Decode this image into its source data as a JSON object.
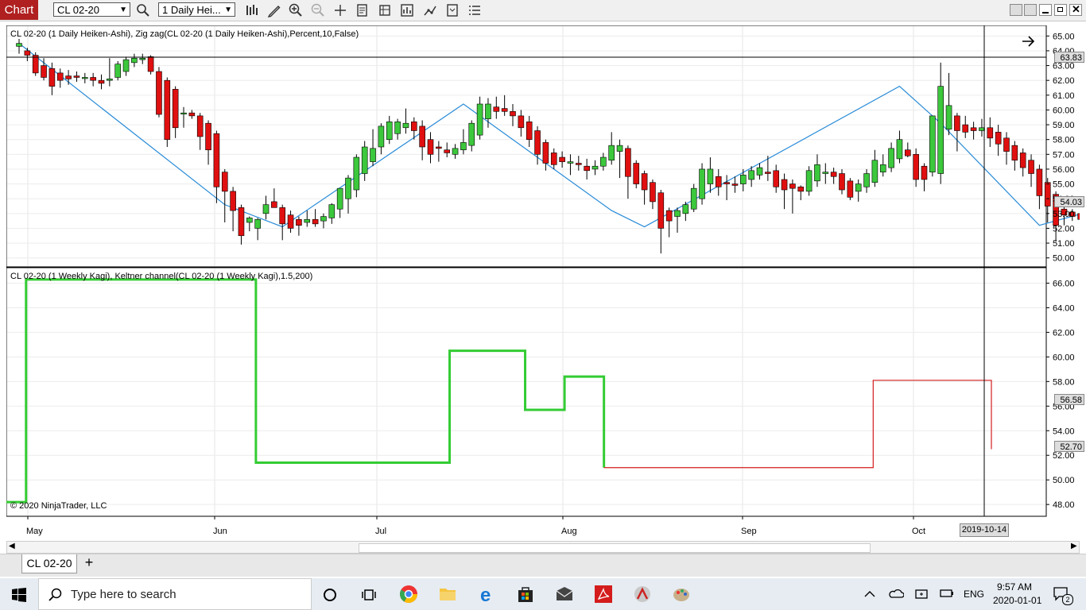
{
  "toolbar": {
    "chart_label": "Chart",
    "instrument": "CL 02-20",
    "period": "1 Daily Hei..."
  },
  "top_panel": {
    "label": "CL 02-20 (1 Daily Heiken-Ashi), Zig zag(CL 02-20 (1 Daily Heiken-Ashi),Percent,10,False)",
    "y_ticks": [
      "65.00",
      "64.00",
      "63.00",
      "62.00",
      "61.00",
      "60.00",
      "59.00",
      "58.00",
      "57.00",
      "56.00",
      "55.00",
      "54.00",
      "53.00",
      "52.00",
      "51.00",
      "50.00"
    ],
    "crosshair_price": "63.83",
    "last_price": "54.03"
  },
  "bottom_panel": {
    "label": "CL 02-20 (1 Weekly Kagi), Keltner channel(CL 02-20 (1 Weekly Kagi),1.5,200)",
    "y_ticks": [
      "66.00",
      "64.00",
      "62.00",
      "60.00",
      "58.00",
      "56.00",
      "54.00",
      "52.00",
      "50.00",
      "48.00"
    ],
    "price_box_1": "56.58",
    "price_box_2": "52.70",
    "copyright": "© 2020 NinjaTrader, LLC"
  },
  "x_axis": {
    "labels": [
      "May",
      "Jun",
      "Jul",
      "Aug",
      "Sep",
      "Oct"
    ],
    "crosshair_date": "2019-10-14"
  },
  "chart_data": [
    {
      "type": "candlestick",
      "title": "CL 02-20 (1 Daily Heiken-Ashi), Zig zag(CL 02-20 (1 Daily Heiken-Ashi),Percent,10,False)",
      "ylim": [
        49.5,
        65.5
      ],
      "candles": [
        [
          64.3,
          64.8,
          63.8,
          64.5
        ],
        [
          64.0,
          64.2,
          63.3,
          63.7
        ],
        [
          63.7,
          63.9,
          62.3,
          62.5
        ],
        [
          63.0,
          63.5,
          62.0,
          62.2
        ],
        [
          62.8,
          63.2,
          61.0,
          61.6
        ],
        [
          62.5,
          62.8,
          61.5,
          62.0
        ],
        [
          62.3,
          62.7,
          61.7,
          62.1
        ],
        [
          62.3,
          62.6,
          61.9,
          62.2
        ],
        [
          62.2,
          62.5,
          61.8,
          62.2
        ],
        [
          62.2,
          62.5,
          61.6,
          62.0
        ],
        [
          62.0,
          62.4,
          61.4,
          61.8
        ],
        [
          62.0,
          63.5,
          61.6,
          62.1
        ],
        [
          62.2,
          63.3,
          62.0,
          63.1
        ],
        [
          62.6,
          63.6,
          62.3,
          63.4
        ],
        [
          63.2,
          63.8,
          62.9,
          63.5
        ],
        [
          63.4,
          63.8,
          63.1,
          63.5
        ],
        [
          63.6,
          63.7,
          62.4,
          62.6
        ],
        [
          62.6,
          62.9,
          59.5,
          59.7
        ],
        [
          62.0,
          62.2,
          57.5,
          58.0
        ],
        [
          61.4,
          61.6,
          58.1,
          58.8
        ],
        [
          59.8,
          60.2,
          58.8,
          59.8
        ],
        [
          59.8,
          60.0,
          59.4,
          59.6
        ],
        [
          59.6,
          59.8,
          57.3,
          58.2
        ],
        [
          59.1,
          59.3,
          56.3,
          57.3
        ],
        [
          58.4,
          58.6,
          53.7,
          54.8
        ],
        [
          55.8,
          56.0,
          52.4,
          54.5
        ],
        [
          54.5,
          54.8,
          51.8,
          53.2
        ],
        [
          53.4,
          53.6,
          50.9,
          51.5
        ],
        [
          52.4,
          52.8,
          51.8,
          52.7
        ],
        [
          52.0,
          52.7,
          51.2,
          52.6
        ],
        [
          53.0,
          54.2,
          52.6,
          53.6
        ],
        [
          53.8,
          54.7,
          53.5,
          53.4
        ],
        [
          53.4,
          53.6,
          51.2,
          52.3
        ],
        [
          52.9,
          53.2,
          51.7,
          52.0
        ],
        [
          52.6,
          52.8,
          51.5,
          52.2
        ],
        [
          52.4,
          53.2,
          52.1,
          52.6
        ],
        [
          52.6,
          53.3,
          52.1,
          52.3
        ],
        [
          52.5,
          53.0,
          52.0,
          52.8
        ],
        [
          52.7,
          53.7,
          52.3,
          53.6
        ],
        [
          53.3,
          54.6,
          52.7,
          54.7
        ],
        [
          54.0,
          55.6,
          53.0,
          55.4
        ],
        [
          54.6,
          57.0,
          54.1,
          56.8
        ],
        [
          55.7,
          57.9,
          55.2,
          57.5
        ],
        [
          56.5,
          58.7,
          56.2,
          57.4
        ],
        [
          57.5,
          59.1,
          57.0,
          58.9
        ],
        [
          58.0,
          59.6,
          57.7,
          59.2
        ],
        [
          58.4,
          59.4,
          58.0,
          59.2
        ],
        [
          58.8,
          60.1,
          58.4,
          59.1
        ],
        [
          59.2,
          59.5,
          58.0,
          58.6
        ],
        [
          58.9,
          59.3,
          56.6,
          57.5
        ],
        [
          58.0,
          58.5,
          56.4,
          57.0
        ],
        [
          57.5,
          57.9,
          56.5,
          57.4
        ],
        [
          57.3,
          57.8,
          56.8,
          57.1
        ],
        [
          57.0,
          57.7,
          56.7,
          57.4
        ],
        [
          57.3,
          58.7,
          57.0,
          57.8
        ],
        [
          57.6,
          59.3,
          57.2,
          59.1
        ],
        [
          58.3,
          60.9,
          58.0,
          60.4
        ],
        [
          59.4,
          60.8,
          58.8,
          60.4
        ],
        [
          60.2,
          60.9,
          59.4,
          59.9
        ],
        [
          60.1,
          61.0,
          59.6,
          59.9
        ],
        [
          59.9,
          60.4,
          58.9,
          59.6
        ],
        [
          59.6,
          60.0,
          58.2,
          58.8
        ],
        [
          59.2,
          59.6,
          57.5,
          58.0
        ],
        [
          58.6,
          58.9,
          56.3,
          57.0
        ],
        [
          57.8,
          58.0,
          55.9,
          56.4
        ],
        [
          57.1,
          57.4,
          56.0,
          56.3
        ],
        [
          56.8,
          57.2,
          56.1,
          56.5
        ],
        [
          56.4,
          57.0,
          55.6,
          56.5
        ],
        [
          56.4,
          56.9,
          55.9,
          56.3
        ],
        [
          56.2,
          56.7,
          55.3,
          55.9
        ],
        [
          56.0,
          56.6,
          55.6,
          56.2
        ],
        [
          56.2,
          57.1,
          55.9,
          56.8
        ],
        [
          56.6,
          58.5,
          56.3,
          57.6
        ],
        [
          57.2,
          58.0,
          55.4,
          57.6
        ],
        [
          57.4,
          57.6,
          54.0,
          55.5
        ],
        [
          56.4,
          56.6,
          54.7,
          55.0
        ],
        [
          55.7,
          55.9,
          53.6,
          54.6
        ],
        [
          55.1,
          55.3,
          53.3,
          53.8
        ],
        [
          54.4,
          54.6,
          50.3,
          52.0
        ],
        [
          53.2,
          53.4,
          51.4,
          52.5
        ],
        [
          52.8,
          53.4,
          51.7,
          53.2
        ],
        [
          53.0,
          53.8,
          52.5,
          53.6
        ],
        [
          53.3,
          55.0,
          53.1,
          54.7
        ],
        [
          54.0,
          56.4,
          53.6,
          56.0
        ],
        [
          55.0,
          56.8,
          54.4,
          56.0
        ],
        [
          55.5,
          56.0,
          54.2,
          54.8
        ],
        [
          55.1,
          55.6,
          53.9,
          55.0
        ],
        [
          55.0,
          55.5,
          54.4,
          54.9
        ],
        [
          55.0,
          56.0,
          54.5,
          55.6
        ],
        [
          55.3,
          56.2,
          54.8,
          55.9
        ],
        [
          55.6,
          56.4,
          55.3,
          56.1
        ],
        [
          55.8,
          56.9,
          55.2,
          55.7
        ],
        [
          55.9,
          56.3,
          54.4,
          54.8
        ],
        [
          55.3,
          55.7,
          53.3,
          54.6
        ],
        [
          55.0,
          55.3,
          53.0,
          54.7
        ],
        [
          54.8,
          54.9,
          53.9,
          54.5
        ],
        [
          54.5,
          56.2,
          54.2,
          55.9
        ],
        [
          55.2,
          57.0,
          54.8,
          56.3
        ],
        [
          55.7,
          56.4,
          55.0,
          55.8
        ],
        [
          55.8,
          56.1,
          55.0,
          55.5
        ],
        [
          55.7,
          56.0,
          54.3,
          54.6
        ],
        [
          55.2,
          55.4,
          53.9,
          54.1
        ],
        [
          54.5,
          55.3,
          53.8,
          55.0
        ],
        [
          54.8,
          56.0,
          54.4,
          55.7
        ],
        [
          55.1,
          57.3,
          54.8,
          56.6
        ],
        [
          55.8,
          57.0,
          55.5,
          56.3
        ],
        [
          56.1,
          57.8,
          55.8,
          57.4
        ],
        [
          56.7,
          58.6,
          56.4,
          58.0
        ],
        [
          57.3,
          57.8,
          56.8,
          56.9
        ],
        [
          57.0,
          57.4,
          54.8,
          55.3
        ],
        [
          56.2,
          56.4,
          54.5,
          55.3
        ],
        [
          55.8,
          58.1,
          55.5,
          59.6
        ],
        [
          55.7,
          63.2,
          55.0,
          61.6
        ],
        [
          58.7,
          62.5,
          58.3,
          60.3
        ],
        [
          59.6,
          59.8,
          57.2,
          58.6
        ],
        [
          59.0,
          59.6,
          58.1,
          58.5
        ],
        [
          58.8,
          59.2,
          58.0,
          58.6
        ],
        [
          58.6,
          59.4,
          58.2,
          58.8
        ],
        [
          58.8,
          59.5,
          57.5,
          58.1
        ],
        [
          58.5,
          59.0,
          56.9,
          57.7
        ],
        [
          58.1,
          58.5,
          56.3,
          57.2
        ],
        [
          57.6,
          57.9,
          55.9,
          56.6
        ],
        [
          57.1,
          57.4,
          55.5,
          56.1
        ],
        [
          56.6,
          57.0,
          54.8,
          55.7
        ],
        [
          56.0,
          56.3,
          53.3,
          54.2
        ],
        [
          55.1,
          55.4,
          52.4,
          53.5
        ],
        [
          54.3,
          54.5,
          51.1,
          52.2
        ],
        [
          53.3,
          53.5,
          52.2,
          52.9
        ],
        [
          53.1,
          53.3,
          52.5,
          52.8
        ],
        [
          53.0,
          53.4,
          52.2,
          52.6
        ],
        [
          52.9,
          53.2,
          52.0,
          52.9
        ],
        [
          52.9,
          53.2,
          51.4,
          53.0
        ],
        [
          52.9,
          54.9,
          52.7,
          54.4
        ],
        [
          53.6,
          55.0,
          53.1,
          54.0
        ],
        [
          54.2,
          54.5,
          52.9,
          53.1
        ],
        [
          53.6,
          53.9,
          52.8,
          53.2
        ],
        [
          53.4,
          53.8,
          52.8,
          53.4
        ],
        [
          53.5,
          54.8,
          53.2,
          53.5
        ],
        [
          53.5,
          54.7,
          53.0,
          53.7
        ],
        [
          53.6,
          54.2,
          53.3,
          53.2
        ],
        [
          53.3,
          54.5,
          53.0,
          53.9
        ]
      ],
      "zigzag": [
        [
          0,
          64.5
        ],
        [
          25,
          53.6
        ],
        [
          32,
          52.1
        ],
        [
          54,
          60.4
        ],
        [
          72,
          53.2
        ],
        [
          76,
          52.1
        ],
        [
          107,
          61.6
        ],
        [
          112,
          59.1
        ],
        [
          124,
          52.2
        ],
        [
          139,
          54.5
        ]
      ]
    },
    {
      "type": "line",
      "title": "CL 02-20 (1 Weekly Kagi), Keltner channel(CL 02-20 (1 Weekly Kagi),1.5,200)",
      "ylim": [
        47.3,
        67.0
      ],
      "kagi": [
        [
          0,
          48.2
        ],
        [
          6,
          48.2
        ],
        [
          6,
          66.3
        ],
        [
          76,
          66.3
        ],
        [
          76,
          51.4
        ],
        [
          135,
          51.4
        ],
        [
          135,
          60.5
        ],
        [
          158,
          60.5
        ],
        [
          158,
          55.7
        ],
        [
          170,
          55.7
        ],
        [
          170,
          58.4
        ],
        [
          182,
          58.4
        ],
        [
          182,
          55.7
        ],
        [
          182,
          51.0
        ],
        [
          264,
          51.0
        ],
        [
          264,
          58.1
        ],
        [
          300,
          58.1
        ],
        [
          300,
          52.5
        ]
      ],
      "kagi_color_change_index": 13
    }
  ],
  "tab": {
    "label": "CL 02-20",
    "add": "+"
  },
  "taskbar": {
    "search_placeholder": "Type here to search",
    "lang": "ENG",
    "time": "9:57 AM",
    "date": "2020-01-01",
    "notif_count": "2"
  },
  "colors": {
    "up": "#3cc83c",
    "down": "#e01010",
    "zigzag": "#2a8cd8",
    "kagi_up": "#33cc33",
    "kagi_down": "#d41c1c"
  }
}
